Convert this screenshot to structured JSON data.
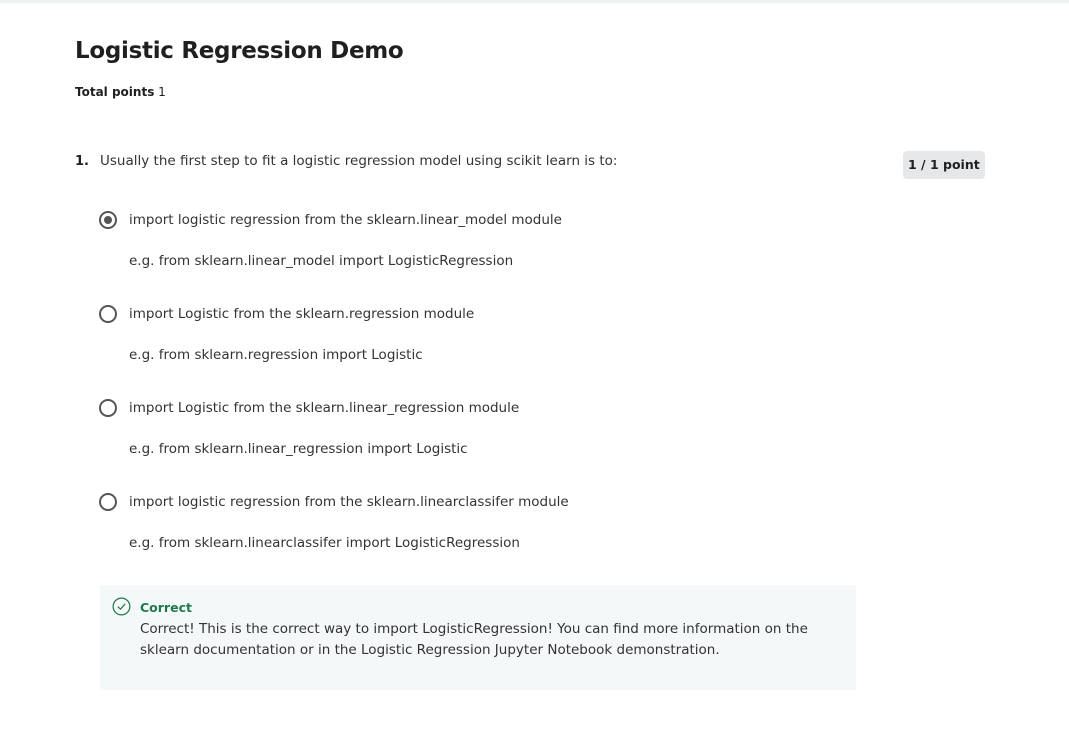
{
  "header": {
    "title": "Logistic Regression Demo",
    "total_label": "Total points",
    "total_value": "1"
  },
  "question": {
    "number": "1.",
    "text": "Usually the first step to fit a logistic regression model using scikit learn is to:",
    "score": "1 / 1 point",
    "options": [
      {
        "label": "import logistic regression from the sklearn.linear_model module",
        "description": "e.g. from sklearn.linear_model import LogisticRegression",
        "selected": true
      },
      {
        "label": "import Logistic from the sklearn.regression module",
        "description": "e.g. from sklearn.regression import Logistic",
        "selected": false
      },
      {
        "label": "import Logistic from the sklearn.linear_regression module",
        "description": "e.g. from sklearn.linear_regression import Logistic",
        "selected": false
      },
      {
        "label": "import logistic regression from the sklearn.linearclassifer module",
        "description": "e.g. from sklearn.linearclassifer import LogisticRegression",
        "selected": false
      }
    ],
    "feedback": {
      "icon": "check-circle-icon",
      "heading": "Correct",
      "text": "Correct! This is the correct way to import LogisticRegression! You can find more information on the sklearn documentation or in the Logistic Regression Jupyter Notebook demonstration.",
      "color": "#1e7a4a"
    }
  }
}
